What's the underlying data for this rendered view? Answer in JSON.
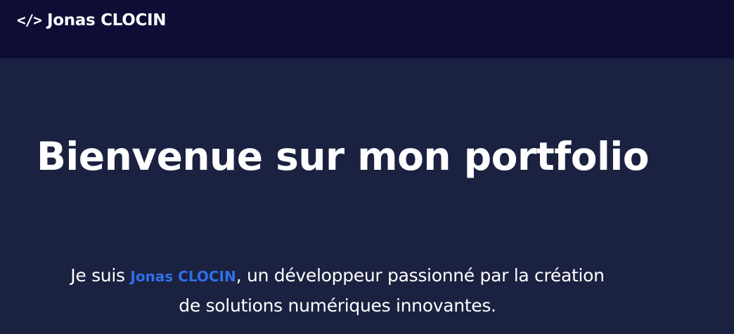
{
  "navbar": {
    "brand_icon": "</>",
    "brand_name": "Jonas CLOCIN"
  },
  "hero": {
    "title": "Bienvenue sur mon portfolio",
    "intro_prefix": "Je suis ",
    "intro_name": "Jonas CLOCIN",
    "intro_suffix_line1": ", un développeur passionné par la création",
    "intro_line2": "de solutions numériques innovantes."
  },
  "colors": {
    "navbar_bg": "#0d0d36",
    "page_bg": "#1b2140",
    "accent": "#2f6fe8",
    "text": "#ffffff"
  },
  "icons": {
    "brand": "code-brackets-icon"
  }
}
